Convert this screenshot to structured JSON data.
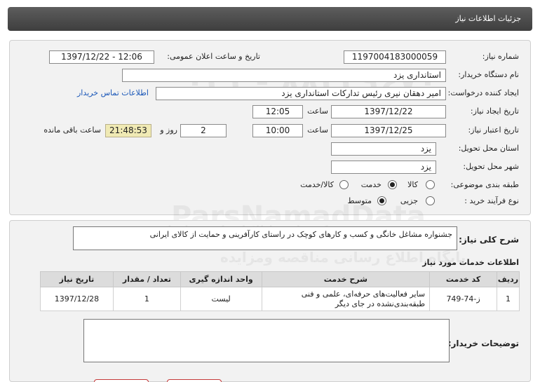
{
  "header": {
    "title": "جزئیات اطلاعات نیاز"
  },
  "form": {
    "need_number_label": "شماره نیاز:",
    "need_number": "1197004183000059",
    "announce_label": "تاریخ و ساعت اعلان عمومی:",
    "announce_value": "1397/12/22 - 12:06",
    "buyer_label": "نام دستگاه خریدار:",
    "buyer_value": "استانداری یزد",
    "creator_label": "ایجاد کننده درخواست:",
    "creator_value": "امیر دهقان نیری رئیس تدارکات استانداری یزد",
    "contact_link": "اطلاعات تماس خریدار",
    "create_date_label": "تاریخ ایجاد نیاز:",
    "create_date": "1397/12/22",
    "time_label": "ساعت",
    "create_time": "12:05",
    "validity_label": "تاریخ اعتبار نیاز:",
    "validity_date": "1397/12/25",
    "validity_time": "10:00",
    "days_value": "2",
    "days_label": "روز و",
    "remaining_time": "21:48:53",
    "remaining_label": "ساعت باقی مانده",
    "province_label": "استان محل تحویل:",
    "province_value": "یزد",
    "city_label": "شهر محل تحویل:",
    "city_value": "یزد",
    "category_label": "طبقه بندی موضوعی:",
    "category_options": [
      "کالا",
      "خدمت",
      "کالا/خدمت"
    ],
    "category_selected": "خدمت",
    "process_label": "نوع فرآیند خرید :",
    "process_options": [
      "جزیی",
      "متوسط"
    ],
    "process_selected": "متوسط"
  },
  "summary": {
    "label": "شرح کلی نیاز:",
    "text": "جشنواره  مشاغل خانگی و کسب و کارهای کوچک در راستای کارآفرینی و حمایت از کالای ایرانی"
  },
  "services": {
    "title": "اطلاعات خدمات مورد نیاز",
    "columns": [
      "ردیف",
      "کد خدمت",
      "شرح خدمت",
      "واحد اندازه گیری",
      "تعداد / مقدار",
      "تاریخ نیاز"
    ],
    "rows": [
      [
        "1",
        "ز-74-749",
        "سایر فعالیت‌های حرفه‌ای، علمی و فنی طبقه‌بندی‌نشده در جای دیگر",
        "لیست",
        "1",
        "1397/12/28"
      ]
    ]
  },
  "buyer_notes": {
    "label": "توضیحات خریدار:",
    "text": ""
  },
  "watermark": {
    "text": "ParsNamadData",
    "subtext": "مرکز فراوری اطلاعات پارس نماد داده",
    "subtext2": "پایگاه اطلاع رسانی مناقصه ومزایده"
  }
}
